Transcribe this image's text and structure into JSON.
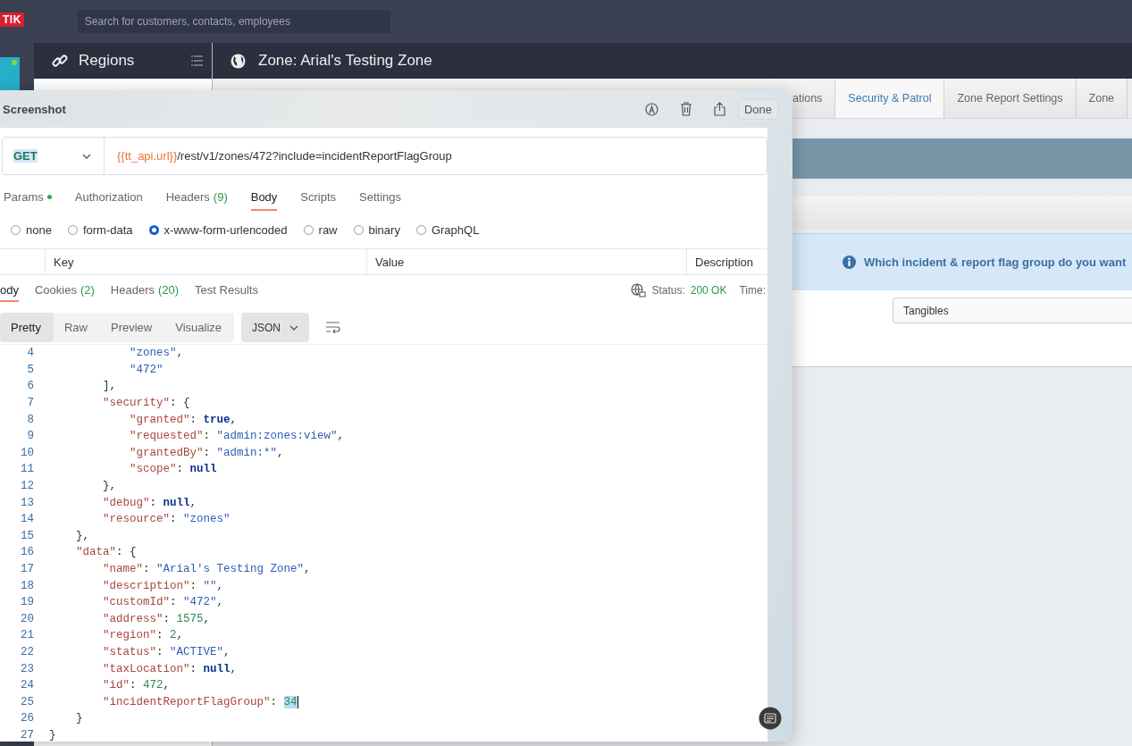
{
  "topbar": {
    "logo": "TIK",
    "search": {
      "placeholder": "Search for customers, contacts, employees"
    }
  },
  "sidebar": {
    "title": "Regions"
  },
  "zone_header": {
    "title": "Zone: Arial's Testing Zone"
  },
  "zone_tabs": [
    {
      "label": "ations",
      "selected": false
    },
    {
      "label": "Security & Patrol",
      "selected": true
    },
    {
      "label": "Zone Report Settings",
      "selected": false
    },
    {
      "label": "Zone",
      "selected": false
    }
  ],
  "zone_content": {
    "info": "Which incident & report flag group do you want",
    "select_value": "Tangibles"
  },
  "screenshot_window": {
    "title": "Screenshot",
    "done": "Done"
  },
  "request": {
    "method": "GET",
    "url_variable": "{{tt_api.url}}",
    "url_path": "/rest/v1/zones/472?include=incidentReportFlagGroup",
    "tabs": [
      {
        "label": "Params",
        "dot": true,
        "selected": false
      },
      {
        "label": "Authorization",
        "dot": false,
        "selected": false
      },
      {
        "label": "Headers",
        "count": "(9)",
        "dot": false,
        "selected": false
      },
      {
        "label": "Body",
        "dot": false,
        "selected": true
      },
      {
        "label": "Scripts",
        "dot": false,
        "selected": false
      },
      {
        "label": "Settings",
        "dot": false,
        "selected": false
      }
    ],
    "body_types": [
      {
        "label": "none",
        "selected": false
      },
      {
        "label": "form-data",
        "selected": false
      },
      {
        "label": "x-www-form-urlencoded",
        "selected": true
      },
      {
        "label": "raw",
        "selected": false
      },
      {
        "label": "binary",
        "selected": false
      },
      {
        "label": "GraphQL",
        "selected": false
      }
    ],
    "table_columns": [
      "Key",
      "Value",
      "Description"
    ]
  },
  "response": {
    "tabs": [
      {
        "label": "ody",
        "selected": true
      },
      {
        "label": "Cookies",
        "count": "(2)",
        "selected": false
      },
      {
        "label": "Headers",
        "count": "(20)",
        "selected": false
      },
      {
        "label": "Test Results",
        "selected": false
      }
    ],
    "status_label": "Status:",
    "status": "200 OK",
    "time_label": "Time:",
    "views": [
      {
        "label": "Pretty",
        "selected": true
      },
      {
        "label": "Raw",
        "selected": false
      },
      {
        "label": "Preview",
        "selected": false
      },
      {
        "label": "Visualize",
        "selected": false
      }
    ],
    "format": "JSON",
    "lines": [
      {
        "num": "4",
        "tokens": [
          {
            "kind": "string",
            "text": "            \"zones\""
          },
          {
            "kind": "punct",
            "text": ","
          }
        ]
      },
      {
        "num": "5",
        "tokens": [
          {
            "kind": "string",
            "text": "            \"472\""
          }
        ]
      },
      {
        "num": "6",
        "tokens": [
          {
            "kind": "punct",
            "text": "        ],"
          }
        ]
      },
      {
        "num": "7",
        "tokens": [
          {
            "kind": "key",
            "text": "        \"security\""
          },
          {
            "kind": "punct",
            "text": ": {"
          }
        ]
      },
      {
        "num": "8",
        "tokens": [
          {
            "kind": "key",
            "text": "            \"granted\""
          },
          {
            "kind": "punct",
            "text": ": "
          },
          {
            "kind": "keyword",
            "text": "true"
          },
          {
            "kind": "punct",
            "text": ","
          }
        ]
      },
      {
        "num": "9",
        "tokens": [
          {
            "kind": "key",
            "text": "            \"requested\""
          },
          {
            "kind": "punct",
            "text": ": "
          },
          {
            "kind": "string",
            "text": "\"admin:zones:view\""
          },
          {
            "kind": "punct",
            "text": ","
          }
        ]
      },
      {
        "num": "10",
        "tokens": [
          {
            "kind": "key",
            "text": "            \"grantedBy\""
          },
          {
            "kind": "punct",
            "text": ": "
          },
          {
            "kind": "string",
            "text": "\"admin:*\""
          },
          {
            "kind": "punct",
            "text": ","
          }
        ]
      },
      {
        "num": "11",
        "tokens": [
          {
            "kind": "key",
            "text": "            \"scope\""
          },
          {
            "kind": "punct",
            "text": ": "
          },
          {
            "kind": "keyword",
            "text": "null"
          }
        ]
      },
      {
        "num": "12",
        "tokens": [
          {
            "kind": "punct",
            "text": "        },"
          }
        ]
      },
      {
        "num": "13",
        "tokens": [
          {
            "kind": "key",
            "text": "        \"debug\""
          },
          {
            "kind": "punct",
            "text": ": "
          },
          {
            "kind": "keyword",
            "text": "null"
          },
          {
            "kind": "punct",
            "text": ","
          }
        ]
      },
      {
        "num": "14",
        "tokens": [
          {
            "kind": "key",
            "text": "        \"resource\""
          },
          {
            "kind": "punct",
            "text": ": "
          },
          {
            "kind": "string",
            "text": "\"zones\""
          }
        ]
      },
      {
        "num": "15",
        "tokens": [
          {
            "kind": "punct",
            "text": "    },"
          }
        ]
      },
      {
        "num": "16",
        "tokens": [
          {
            "kind": "key",
            "text": "    \"data\""
          },
          {
            "kind": "punct",
            "text": ": {"
          }
        ]
      },
      {
        "num": "17",
        "tokens": [
          {
            "kind": "key",
            "text": "        \"name\""
          },
          {
            "kind": "punct",
            "text": ": "
          },
          {
            "kind": "string",
            "text": "\"Arial's Testing Zone\""
          },
          {
            "kind": "punct",
            "text": ","
          }
        ]
      },
      {
        "num": "18",
        "tokens": [
          {
            "kind": "key",
            "text": "        \"description\""
          },
          {
            "kind": "punct",
            "text": ": "
          },
          {
            "kind": "string",
            "text": "\"\""
          },
          {
            "kind": "punct",
            "text": ","
          }
        ]
      },
      {
        "num": "19",
        "tokens": [
          {
            "kind": "key",
            "text": "        \"customId\""
          },
          {
            "kind": "punct",
            "text": ": "
          },
          {
            "kind": "string",
            "text": "\"472\""
          },
          {
            "kind": "punct",
            "text": ","
          }
        ]
      },
      {
        "num": "20",
        "tokens": [
          {
            "kind": "key",
            "text": "        \"address\""
          },
          {
            "kind": "punct",
            "text": ": "
          },
          {
            "kind": "number",
            "text": "1575"
          },
          {
            "kind": "punct",
            "text": ","
          }
        ]
      },
      {
        "num": "21",
        "tokens": [
          {
            "kind": "key",
            "text": "        \"region\""
          },
          {
            "kind": "punct",
            "text": ": "
          },
          {
            "kind": "number",
            "text": "2"
          },
          {
            "kind": "punct",
            "text": ","
          }
        ]
      },
      {
        "num": "22",
        "tokens": [
          {
            "kind": "key",
            "text": "        \"status\""
          },
          {
            "kind": "punct",
            "text": ": "
          },
          {
            "kind": "string",
            "text": "\"ACTIVE\""
          },
          {
            "kind": "punct",
            "text": ","
          }
        ]
      },
      {
        "num": "23",
        "tokens": [
          {
            "kind": "key",
            "text": "        \"taxLocation\""
          },
          {
            "kind": "punct",
            "text": ": "
          },
          {
            "kind": "keyword",
            "text": "null"
          },
          {
            "kind": "punct",
            "text": ","
          }
        ]
      },
      {
        "num": "24",
        "tokens": [
          {
            "kind": "key",
            "text": "        \"id\""
          },
          {
            "kind": "punct",
            "text": ": "
          },
          {
            "kind": "number",
            "text": "472"
          },
          {
            "kind": "punct",
            "text": ","
          }
        ]
      },
      {
        "num": "25",
        "tokens": [
          {
            "kind": "key",
            "text": "        \"incidentReportFlagGroup\""
          },
          {
            "kind": "punct",
            "text": ": "
          },
          {
            "kind": "selection",
            "text": "34"
          }
        ]
      },
      {
        "num": "26",
        "tokens": [
          {
            "kind": "punct",
            "text": "    }"
          }
        ]
      },
      {
        "num": "27",
        "tokens": [
          {
            "kind": "punct",
            "text": "}"
          }
        ]
      }
    ]
  }
}
